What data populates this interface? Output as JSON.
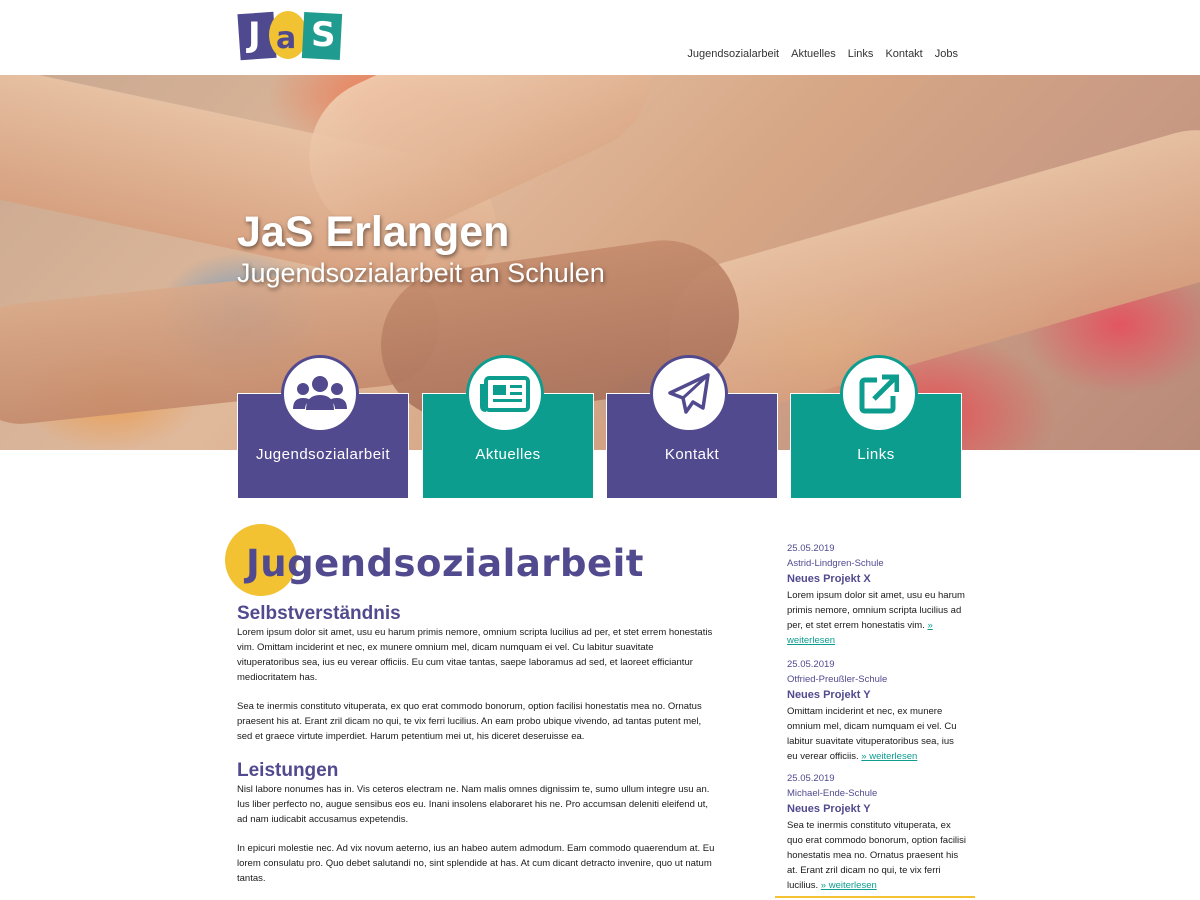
{
  "logo": {
    "letters": [
      "J",
      "a",
      "S"
    ]
  },
  "nav": [
    "Jugendsozialarbeit",
    "Aktuelles",
    "Links",
    "Kontakt",
    "Jobs"
  ],
  "hero": {
    "title": "JaS Erlangen",
    "subtitle": "Jugendsozialarbeit an Schulen"
  },
  "tiles": [
    {
      "label": "Jugendsozialarbeit",
      "icon": "users-icon",
      "color": "#514a8e"
    },
    {
      "label": "Aktuelles",
      "icon": "newspaper-icon",
      "color": "#0d9d8f"
    },
    {
      "label": "Kontakt",
      "icon": "paper-plane-icon",
      "color": "#514a8e"
    },
    {
      "label": "Links",
      "icon": "external-link-icon",
      "color": "#0d9d8f"
    }
  ],
  "main": {
    "title": "Jugendsozialarbeit",
    "sections": [
      {
        "heading": "Selbstverständnis",
        "paragraphs": [
          "Lorem ipsum dolor sit amet, usu eu harum primis nemore, omnium scripta lucilius ad per, et stet errem honestatis vim. Omittam inciderint et nec, ex munere omnium mel, dicam numquam ei vel. Cu labitur suavitate vituperatoribus sea, ius eu verear officiis. Eu cum vitae tantas, saepe laboramus ad sed, et laoreet efficiantur mediocritatem has.",
          "Sea te inermis constituto vituperata, ex quo erat commodo bonorum, option facilisi honestatis mea no. Ornatus praesent his at. Erant zril dicam no qui, te vix ferri lucilius. An eam probo ubique vivendo, ad tantas putent mel, sed et graece virtute imperdiet. Harum petentium mei ut, his diceret deseruisse ea."
        ]
      },
      {
        "heading": "Leistungen",
        "paragraphs": [
          "Nisl labore nonumes has in. Vis ceteros electram ne. Nam malis omnes dignissim te, sumo ullum integre usu an. Ius liber perfecto no, augue sensibus eos eu. Inani insolens elaboraret his ne. Pro accumsan deleniti eleifend ut, ad nam iudicabit accusamus expetendis.",
          "In epicuri molestie nec. Ad vix novum aeterno, ius an habeo autem admodum. Eam commodo quaerendum at. Eu lorem consulatu pro. Quo debet salutandi no, sint splendide at has. At cum dicant detracto invenire, quo ut natum tantas."
        ]
      }
    ]
  },
  "news": [
    {
      "date": "25.05.2019",
      "school": "Astrid-Lindgren-Schule",
      "title": "Neues Projekt X",
      "text": "Lorem ipsum dolor sit amet, usu eu harum primis nemore, omnium scripta lucilius ad per, et stet errem honestatis vim.",
      "more": "» weiterlesen"
    },
    {
      "date": "25.05.2019",
      "school": "Otfried-Preußler-Schule",
      "title": "Neues Projekt Y",
      "text": "Omittam inciderint et nec, ex munere omnium mel, dicam numquam ei vel. Cu labitur suavitate vituperatoribus sea, ius eu verear officiis.",
      "more": "» weiterlesen"
    },
    {
      "date": "25.05.2019",
      "school": "Michael-Ende-Schule",
      "title": "Neues Projekt Y",
      "text": "Sea te inermis constituto vituperata, ex quo erat commodo bonorum, option facilisi honestatis mea no. Ornatus praesent his at. Erant zril dicam no qui, te vix ferri lucilius.",
      "more": "» weiterlesen"
    }
  ],
  "colors": {
    "purple": "#514a8e",
    "teal": "#0d9d8f",
    "yellow": "#f2c233"
  }
}
